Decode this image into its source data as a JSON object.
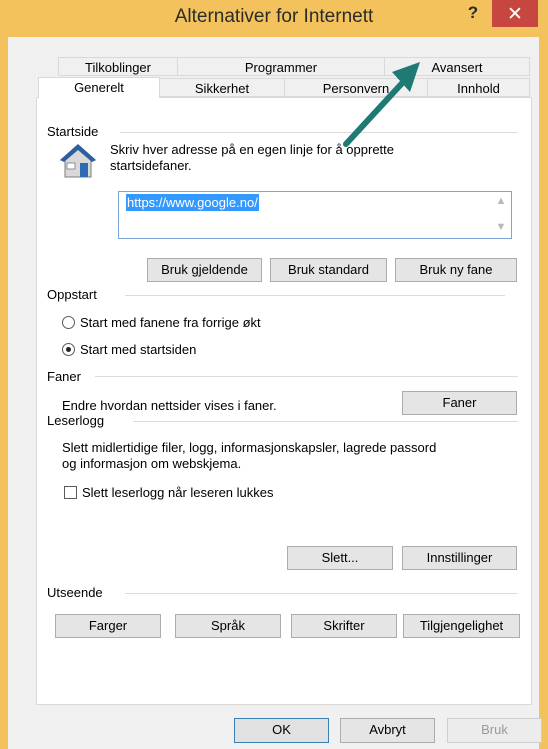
{
  "window": {
    "title": "Alternativer for Internett",
    "help_label": "?",
    "close_label": "✕"
  },
  "tabs": {
    "row1": [
      "Tilkoblinger",
      "Programmer",
      "Avansert"
    ],
    "row2": [
      "Generelt",
      "Sikkerhet",
      "Personvern",
      "Innhold"
    ],
    "active": "Generelt"
  },
  "startside": {
    "label": "Startside",
    "description_line1": "Skriv hver adresse på en egen linje for å opprette",
    "description_line2": "startsidefaner.",
    "url": "https://www.google.no/",
    "buttons": [
      "Bruk gjeldende",
      "Bruk standard",
      "Bruk ny fane"
    ]
  },
  "oppstart": {
    "label": "Oppstart",
    "options": [
      {
        "label": "Start med fanene fra forrige økt",
        "checked": false
      },
      {
        "label": "Start med startsiden",
        "checked": true
      }
    ]
  },
  "faner": {
    "label": "Faner",
    "description": "Endre hvordan nettsider vises i faner.",
    "button": "Faner"
  },
  "leserlogg": {
    "label": "Leserlogg",
    "description_line1": "Slett midlertidige filer, logg, informasjonskapsler, lagrede passord",
    "description_line2": "og informasjon om webskjema.",
    "checkbox_label": "Slett leserlogg når leseren lukkes",
    "checkbox_checked": false,
    "delete_button": "Slett...",
    "settings_button": "Innstillinger"
  },
  "utseende": {
    "label": "Utseende",
    "buttons": [
      "Farger",
      "Språk",
      "Skrifter",
      "Tilgjengelighet"
    ]
  },
  "footer": {
    "ok": "OK",
    "cancel": "Avbryt",
    "apply": "Bruk"
  },
  "colors": {
    "titlebar": "#f3c25c",
    "close": "#c7463f",
    "selection": "#3399ff",
    "annotation_arrow": "#1f7a73"
  },
  "icons": {
    "house": "house-icon",
    "annotation": "annotation-arrow"
  }
}
